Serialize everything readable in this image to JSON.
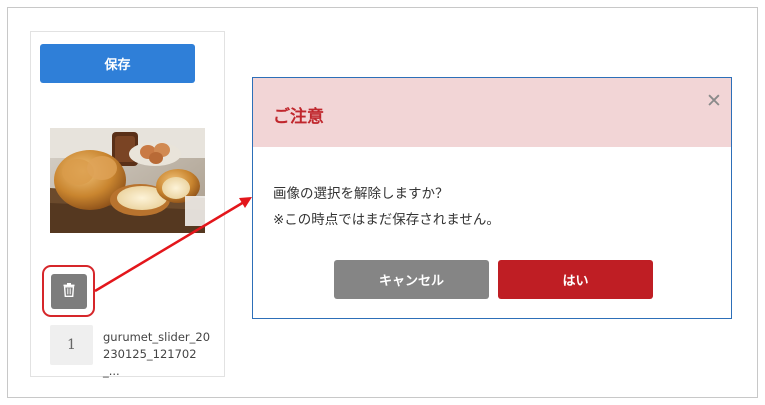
{
  "editor": {
    "save_label": "保存",
    "items": [
      {
        "order": "1",
        "filename": "gurumet_slider_20230125_121702_..."
      }
    ]
  },
  "dialog": {
    "title": "ご注意",
    "close_glyph": "✕",
    "message_line1": "画像の選択を解除しますか？",
    "message_line2": "※この時点ではまだ保存されません。",
    "cancel_label": "キャンセル",
    "confirm_label": "はい"
  },
  "colors": {
    "save_button": "#2f7fd8",
    "header_bg": "#f2d5d6",
    "title_red": "#c0272d",
    "confirm_red": "#bf1e24",
    "cancel_gray": "#858585",
    "highlight_red": "#d6262a"
  },
  "icons": {
    "delete": "trash-icon",
    "close": "close-icon"
  }
}
